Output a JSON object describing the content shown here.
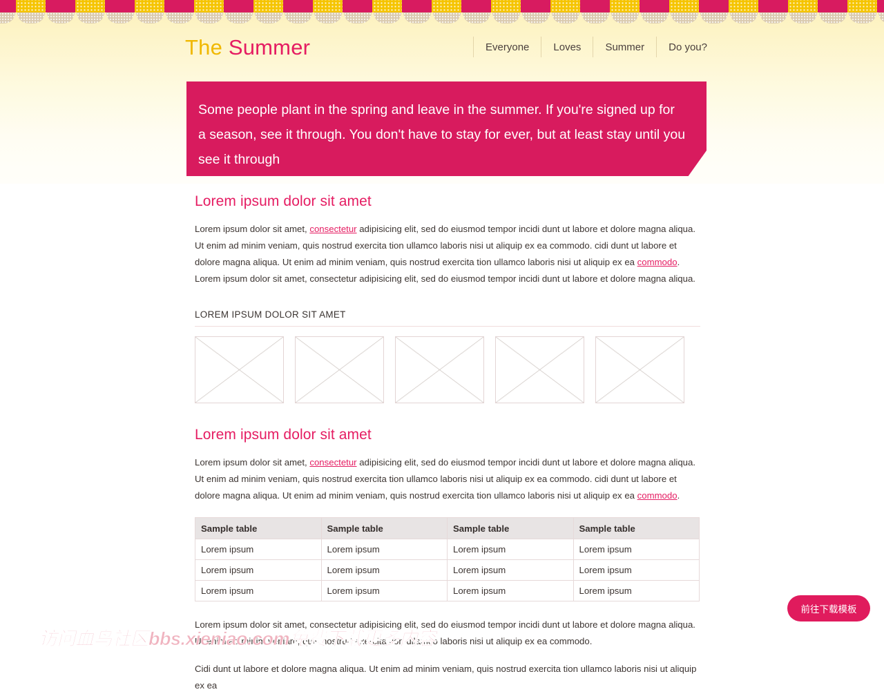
{
  "brand": {
    "word1": "The ",
    "word2": "Summer",
    "color1": "#f0b800",
    "color2": "#e51c62"
  },
  "nav": {
    "items": [
      {
        "label": "Everyone"
      },
      {
        "label": "Loves"
      },
      {
        "label": "Summer"
      },
      {
        "label": "Do you?"
      }
    ]
  },
  "callout": {
    "text": "Some people plant in the spring and leave in the summer. If you're signed up for a season, see it through. You don't have to stay for ever, but at least stay until you see it through",
    "background": "#d81b5e",
    "text_color": "#ffffff"
  },
  "sections": {
    "first": {
      "title": "Lorem ipsum dolor sit amet",
      "paragraph_parts": {
        "p1": "Lorem ipsum dolor sit amet, ",
        "link1": "consectetur",
        "p2": " adipisicing elit, sed do eiusmod tempor incidi dunt ut labore et dolore magna aliqua. Ut enim ad minim veniam, quis nostrud exercita tion ullamco laboris nisi ut aliquip ex ea commodo. cidi dunt ut labore et dolore magna aliqua. Ut enim ad minim veniam, quis nostrud exercita tion ullamco laboris nisi ut aliquip ex ea ",
        "link2": "commodo",
        "p3": ". Lorem ipsum dolor sit amet, consectetur adipisicing elit, sed do eiusmod tempor incidi dunt ut labore et dolore magna aliqua."
      }
    },
    "gallery": {
      "title": "LOREM IPSUM DOLOR SIT AMET",
      "thumbnails": [
        {
          "alt": "broken-image-placeholder-1"
        },
        {
          "alt": "broken-image-placeholder-2"
        },
        {
          "alt": "broken-image-placeholder-3"
        },
        {
          "alt": "broken-image-placeholder-4"
        },
        {
          "alt": "broken-image-placeholder-5"
        }
      ]
    },
    "second": {
      "title": "Lorem ipsum dolor sit amet",
      "paragraph_parts": {
        "p1": "Lorem ipsum dolor sit amet, ",
        "link1": "consectetur",
        "p2": " adipisicing elit, sed do eiusmod tempor incidi dunt ut labore et dolore magna aliqua. Ut enim ad minim veniam, quis nostrud exercita tion ullamco laboris nisi ut aliquip ex ea commodo. cidi dunt ut labore et dolore magna aliqua. Ut enim ad minim veniam, quis nostrud exercita tion ullamco laboris nisi ut aliquip ex ea ",
        "link2": "commodo",
        "p3": "."
      }
    },
    "table": {
      "headers": [
        "Sample table",
        "Sample table",
        "Sample table",
        "Sample table"
      ],
      "rows": [
        [
          "Lorem ipsum",
          "Lorem ipsum",
          "Lorem ipsum",
          "Lorem ipsum"
        ],
        [
          "Lorem ipsum",
          "Lorem ipsum",
          "Lorem ipsum",
          "Lorem ipsum"
        ],
        [
          "Lorem ipsum",
          "Lorem ipsum",
          "Lorem ipsum",
          "Lorem ipsum"
        ]
      ]
    },
    "closing": {
      "paragraph1": "Lorem ipsum dolor sit amet, consectetur adipisicing elit, sed do eiusmod tempor incidi dunt ut labore et dolore magna aliqua. Ut enim ad minim veniam, quis nostrud exercita tion ullamco laboris nisi ut aliquip ex ea commodo.",
      "paragraph2": "Cidi dunt ut labore et dolore magna aliqua. Ut enim ad minim veniam, quis nostrud exercita tion ullamco laboris nisi ut aliquip ex ea"
    }
  },
  "download_button": {
    "label": "前往下载模板",
    "color": "#e01b5d"
  },
  "watermark": {
    "text": "访问血鸟社区bbs.xieniao.com免费下载更多内容",
    "color": "#f0b4c0"
  }
}
